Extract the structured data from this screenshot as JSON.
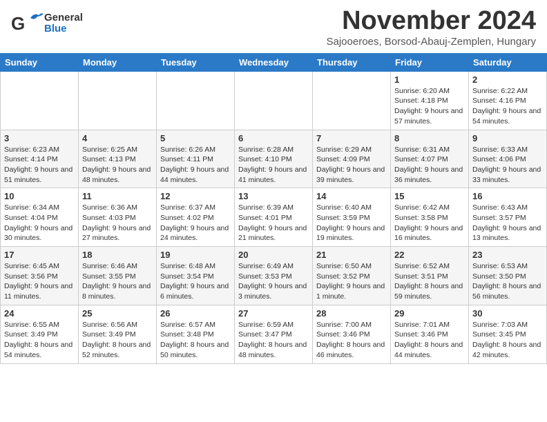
{
  "header": {
    "logo_general": "General",
    "logo_blue": "Blue",
    "title": "November 2024",
    "subtitle": "Sajooeroes, Borsod-Abauj-Zemplen, Hungary"
  },
  "days_of_week": [
    "Sunday",
    "Monday",
    "Tuesday",
    "Wednesday",
    "Thursday",
    "Friday",
    "Saturday"
  ],
  "weeks": [
    {
      "days": [
        {
          "num": "",
          "info": ""
        },
        {
          "num": "",
          "info": ""
        },
        {
          "num": "",
          "info": ""
        },
        {
          "num": "",
          "info": ""
        },
        {
          "num": "",
          "info": ""
        },
        {
          "num": "1",
          "info": "Sunrise: 6:20 AM\nSunset: 4:18 PM\nDaylight: 9 hours and 57 minutes."
        },
        {
          "num": "2",
          "info": "Sunrise: 6:22 AM\nSunset: 4:16 PM\nDaylight: 9 hours and 54 minutes."
        }
      ]
    },
    {
      "days": [
        {
          "num": "3",
          "info": "Sunrise: 6:23 AM\nSunset: 4:14 PM\nDaylight: 9 hours and 51 minutes."
        },
        {
          "num": "4",
          "info": "Sunrise: 6:25 AM\nSunset: 4:13 PM\nDaylight: 9 hours and 48 minutes."
        },
        {
          "num": "5",
          "info": "Sunrise: 6:26 AM\nSunset: 4:11 PM\nDaylight: 9 hours and 44 minutes."
        },
        {
          "num": "6",
          "info": "Sunrise: 6:28 AM\nSunset: 4:10 PM\nDaylight: 9 hours and 41 minutes."
        },
        {
          "num": "7",
          "info": "Sunrise: 6:29 AM\nSunset: 4:09 PM\nDaylight: 9 hours and 39 minutes."
        },
        {
          "num": "8",
          "info": "Sunrise: 6:31 AM\nSunset: 4:07 PM\nDaylight: 9 hours and 36 minutes."
        },
        {
          "num": "9",
          "info": "Sunrise: 6:33 AM\nSunset: 4:06 PM\nDaylight: 9 hours and 33 minutes."
        }
      ]
    },
    {
      "days": [
        {
          "num": "10",
          "info": "Sunrise: 6:34 AM\nSunset: 4:04 PM\nDaylight: 9 hours and 30 minutes."
        },
        {
          "num": "11",
          "info": "Sunrise: 6:36 AM\nSunset: 4:03 PM\nDaylight: 9 hours and 27 minutes."
        },
        {
          "num": "12",
          "info": "Sunrise: 6:37 AM\nSunset: 4:02 PM\nDaylight: 9 hours and 24 minutes."
        },
        {
          "num": "13",
          "info": "Sunrise: 6:39 AM\nSunset: 4:01 PM\nDaylight: 9 hours and 21 minutes."
        },
        {
          "num": "14",
          "info": "Sunrise: 6:40 AM\nSunset: 3:59 PM\nDaylight: 9 hours and 19 minutes."
        },
        {
          "num": "15",
          "info": "Sunrise: 6:42 AM\nSunset: 3:58 PM\nDaylight: 9 hours and 16 minutes."
        },
        {
          "num": "16",
          "info": "Sunrise: 6:43 AM\nSunset: 3:57 PM\nDaylight: 9 hours and 13 minutes."
        }
      ]
    },
    {
      "days": [
        {
          "num": "17",
          "info": "Sunrise: 6:45 AM\nSunset: 3:56 PM\nDaylight: 9 hours and 11 minutes."
        },
        {
          "num": "18",
          "info": "Sunrise: 6:46 AM\nSunset: 3:55 PM\nDaylight: 9 hours and 8 minutes."
        },
        {
          "num": "19",
          "info": "Sunrise: 6:48 AM\nSunset: 3:54 PM\nDaylight: 9 hours and 6 minutes."
        },
        {
          "num": "20",
          "info": "Sunrise: 6:49 AM\nSunset: 3:53 PM\nDaylight: 9 hours and 3 minutes."
        },
        {
          "num": "21",
          "info": "Sunrise: 6:50 AM\nSunset: 3:52 PM\nDaylight: 9 hours and 1 minute."
        },
        {
          "num": "22",
          "info": "Sunrise: 6:52 AM\nSunset: 3:51 PM\nDaylight: 8 hours and 59 minutes."
        },
        {
          "num": "23",
          "info": "Sunrise: 6:53 AM\nSunset: 3:50 PM\nDaylight: 8 hours and 56 minutes."
        }
      ]
    },
    {
      "days": [
        {
          "num": "24",
          "info": "Sunrise: 6:55 AM\nSunset: 3:49 PM\nDaylight: 8 hours and 54 minutes."
        },
        {
          "num": "25",
          "info": "Sunrise: 6:56 AM\nSunset: 3:49 PM\nDaylight: 8 hours and 52 minutes."
        },
        {
          "num": "26",
          "info": "Sunrise: 6:57 AM\nSunset: 3:48 PM\nDaylight: 8 hours and 50 minutes."
        },
        {
          "num": "27",
          "info": "Sunrise: 6:59 AM\nSunset: 3:47 PM\nDaylight: 8 hours and 48 minutes."
        },
        {
          "num": "28",
          "info": "Sunrise: 7:00 AM\nSunset: 3:46 PM\nDaylight: 8 hours and 46 minutes."
        },
        {
          "num": "29",
          "info": "Sunrise: 7:01 AM\nSunset: 3:46 PM\nDaylight: 8 hours and 44 minutes."
        },
        {
          "num": "30",
          "info": "Sunrise: 7:03 AM\nSunset: 3:45 PM\nDaylight: 8 hours and 42 minutes."
        }
      ]
    }
  ],
  "accent_color": "#2a7ac7"
}
